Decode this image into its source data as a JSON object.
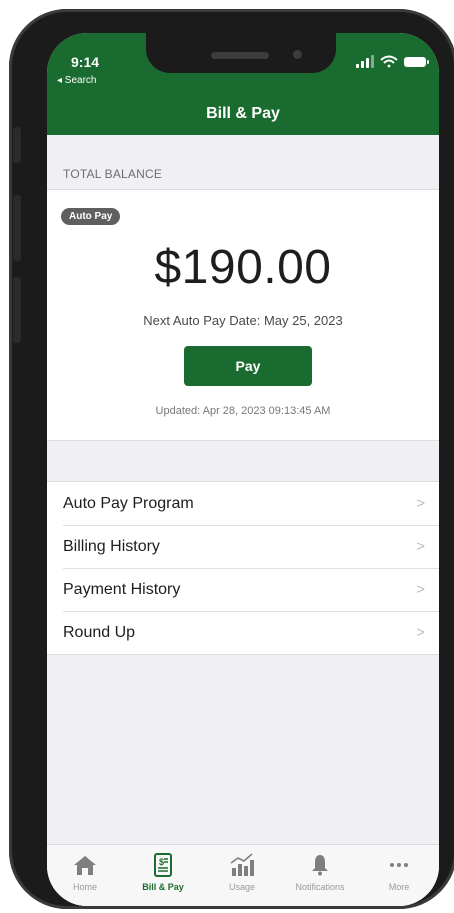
{
  "status_bar": {
    "time": "9:14",
    "back_label": "◂ Search"
  },
  "header": {
    "title": "Bill & Pay"
  },
  "balance": {
    "section_label": "TOTAL BALANCE",
    "badge": "Auto Pay",
    "amount": "$190.00",
    "next_auto_pay": "Next Auto Pay Date: May 25, 2023",
    "pay_label": "Pay",
    "updated": "Updated: Apr 28, 2023 09:13:45 AM"
  },
  "menu": {
    "items": [
      {
        "label": "Auto Pay Program"
      },
      {
        "label": "Billing History"
      },
      {
        "label": "Payment History"
      },
      {
        "label": "Round Up"
      }
    ]
  },
  "tabs": [
    {
      "label": "Home",
      "icon": "home-icon",
      "active": false
    },
    {
      "label": "Bill & Pay",
      "icon": "bill-icon",
      "active": true
    },
    {
      "label": "Usage",
      "icon": "usage-chart-icon",
      "active": false
    },
    {
      "label": "Notifications",
      "icon": "bell-icon",
      "active": false
    },
    {
      "label": "More",
      "icon": "more-icon",
      "active": false
    }
  ],
  "colors": {
    "brand_green": "#1a6b30",
    "badge_gray": "#5f5f5f"
  }
}
